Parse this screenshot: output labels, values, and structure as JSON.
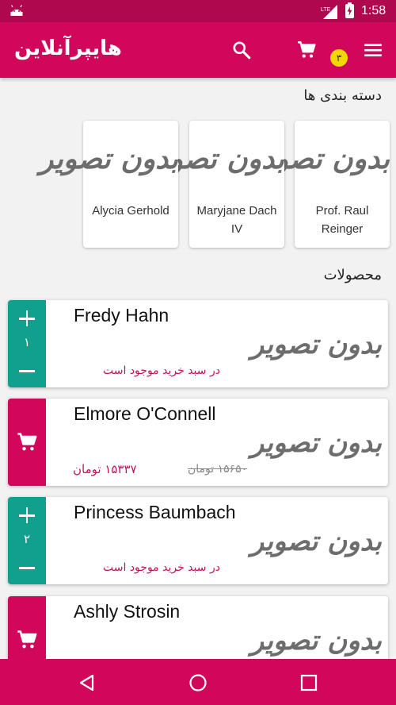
{
  "status_bar": {
    "network": "LTE",
    "time": "1:58"
  },
  "app_bar": {
    "title": "هایپرآنلاین",
    "cart_count": "۳",
    "icons": [
      "menu-icon",
      "cart-icon",
      "search-icon"
    ]
  },
  "categories_section": {
    "title": "دسته بندی ها",
    "items": [
      {
        "image_text": "بدون تصویر",
        "name": "Prof. Raul Reinger"
      },
      {
        "image_text": "بدون تصویر",
        "name": "Maryjane Dach IV"
      },
      {
        "image_text": "بدون تصویر",
        "name": "Alycia Gerhold"
      }
    ]
  },
  "products_section": {
    "title": "محصولات",
    "items": [
      {
        "name": "Fredy Hahn",
        "image_text": "بدون تصویر",
        "quantity": "۱",
        "status": "در سبد خرید موجود است"
      },
      {
        "name": "Elmore O'Connell",
        "image_text": "بدون تصویر",
        "old_price": "۱۵۶۵۰ تومان",
        "new_price": "۱۵۳۳۷ تومان"
      },
      {
        "name": "Princess Baumbach",
        "image_text": "بدون تصویر",
        "quantity": "۲",
        "status": "در سبد خرید موجود است"
      },
      {
        "name": "Ashly Strosin",
        "image_text": "بدون تصویر"
      }
    ]
  },
  "colors": {
    "primary": "#d1075c",
    "status_bar": "#b0084f",
    "teal": "#12a08e",
    "badge": "#f2d800"
  }
}
